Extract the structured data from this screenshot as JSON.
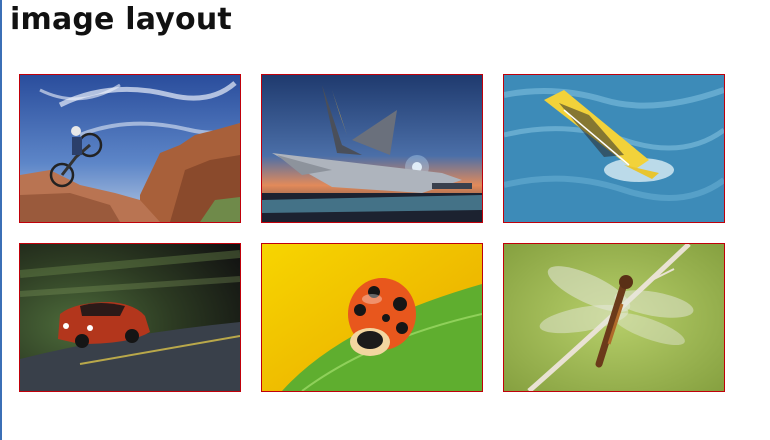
{
  "page": {
    "title": "image layout"
  },
  "gallery": {
    "border_color": "#c0000a",
    "images": [
      {
        "subject": "bmx-rider-desert"
      },
      {
        "subject": "airplane-sunset"
      },
      {
        "subject": "windsurfer-waves"
      },
      {
        "subject": "red-car-motion"
      },
      {
        "subject": "ladybug-leaf"
      },
      {
        "subject": "dragonfly-twig"
      }
    ]
  }
}
